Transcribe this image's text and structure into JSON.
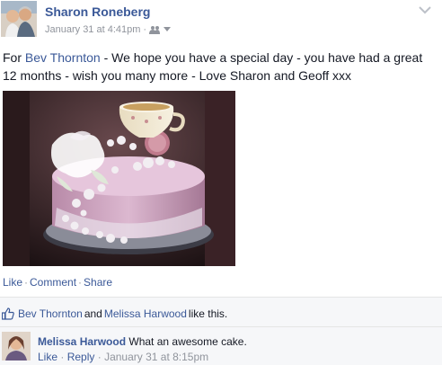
{
  "post": {
    "author": "Sharon Roneberg",
    "timestamp": "January 31 at 4:41pm",
    "separator": "·",
    "privacy_icon": "friends-icon",
    "text_prefix": "For ",
    "tagged": "Bev Thornton",
    "text_suffix": " - We hope you have a special day - you have had a great 12 months - wish you many more - Love Sharon and Geoff xxx",
    "photo_icon": "cake-photo"
  },
  "actions": {
    "like": "Like",
    "comment": "Comment",
    "share": "Share",
    "sep": "·"
  },
  "likes": {
    "user1": "Bev Thornton",
    "and": "and",
    "user2": "Melissa Harwood",
    "suffix": "like this."
  },
  "comment": {
    "author": "Melissa Harwood",
    "text": "What an awesome cake.",
    "like": "Like",
    "reply": "Reply",
    "sep": "·",
    "timestamp": "January 31 at 8:15pm"
  },
  "colors": {
    "link": "#3b5998",
    "meta": "#90949c",
    "ufi_bg": "#f6f7f9"
  }
}
